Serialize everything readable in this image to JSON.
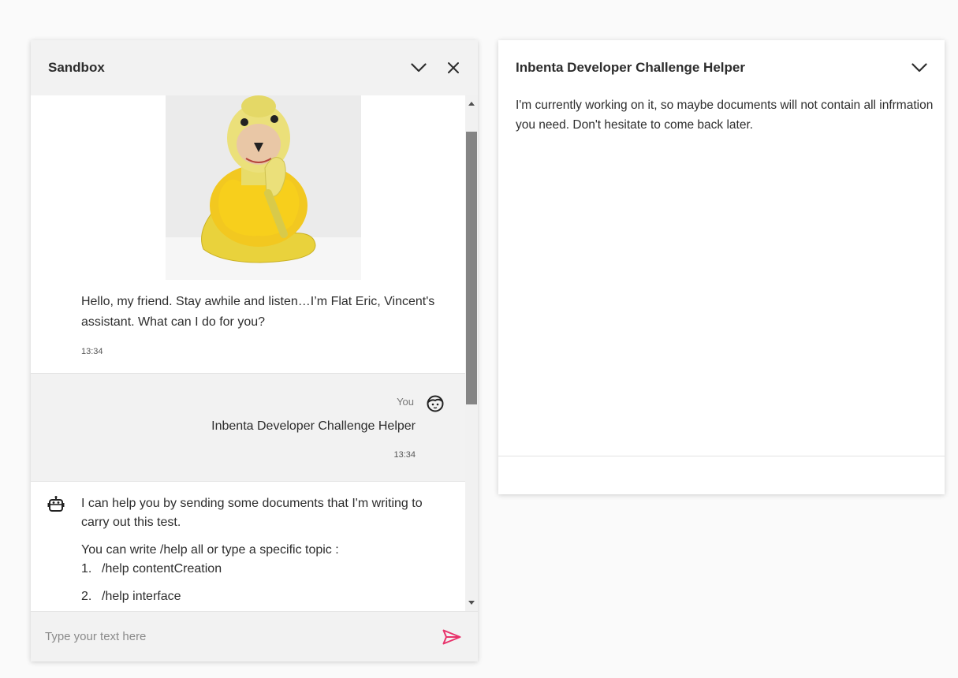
{
  "chat": {
    "title": "Sandbox",
    "minimize_icon": "chevron-down-icon",
    "close_icon": "close-icon",
    "intro_message": {
      "image_alt": "flat-eric-puppet-photo",
      "text": "Hello, my friend. Stay awhile and listen…I’m Flat Eric, Vincent's assistant. What can I do for you?",
      "time": "13:34"
    },
    "user_message": {
      "sender": "You",
      "text": "Inbenta Developer Challenge Helper",
      "time": "13:34"
    },
    "bot_message": {
      "paragraph1": "I can help you by sending some documents that I'm writing to carry out this test.",
      "paragraph2": "You can write /help all or type a specific topic :",
      "list": [
        {
          "num": "1.",
          "text": "/help contentCreation"
        },
        {
          "num": "2.",
          "text": "/help interface"
        }
      ]
    },
    "input": {
      "placeholder": "Type your text here",
      "value": ""
    },
    "send_icon": "send-icon",
    "accent_color": "#e8336b"
  },
  "panel": {
    "title": "Inbenta Developer Challenge Helper",
    "toggle_icon": "chevron-down-icon",
    "text": "I'm currently working on it, so maybe documents will not contain all infrmation you need. Don't hesitate to come back later."
  }
}
